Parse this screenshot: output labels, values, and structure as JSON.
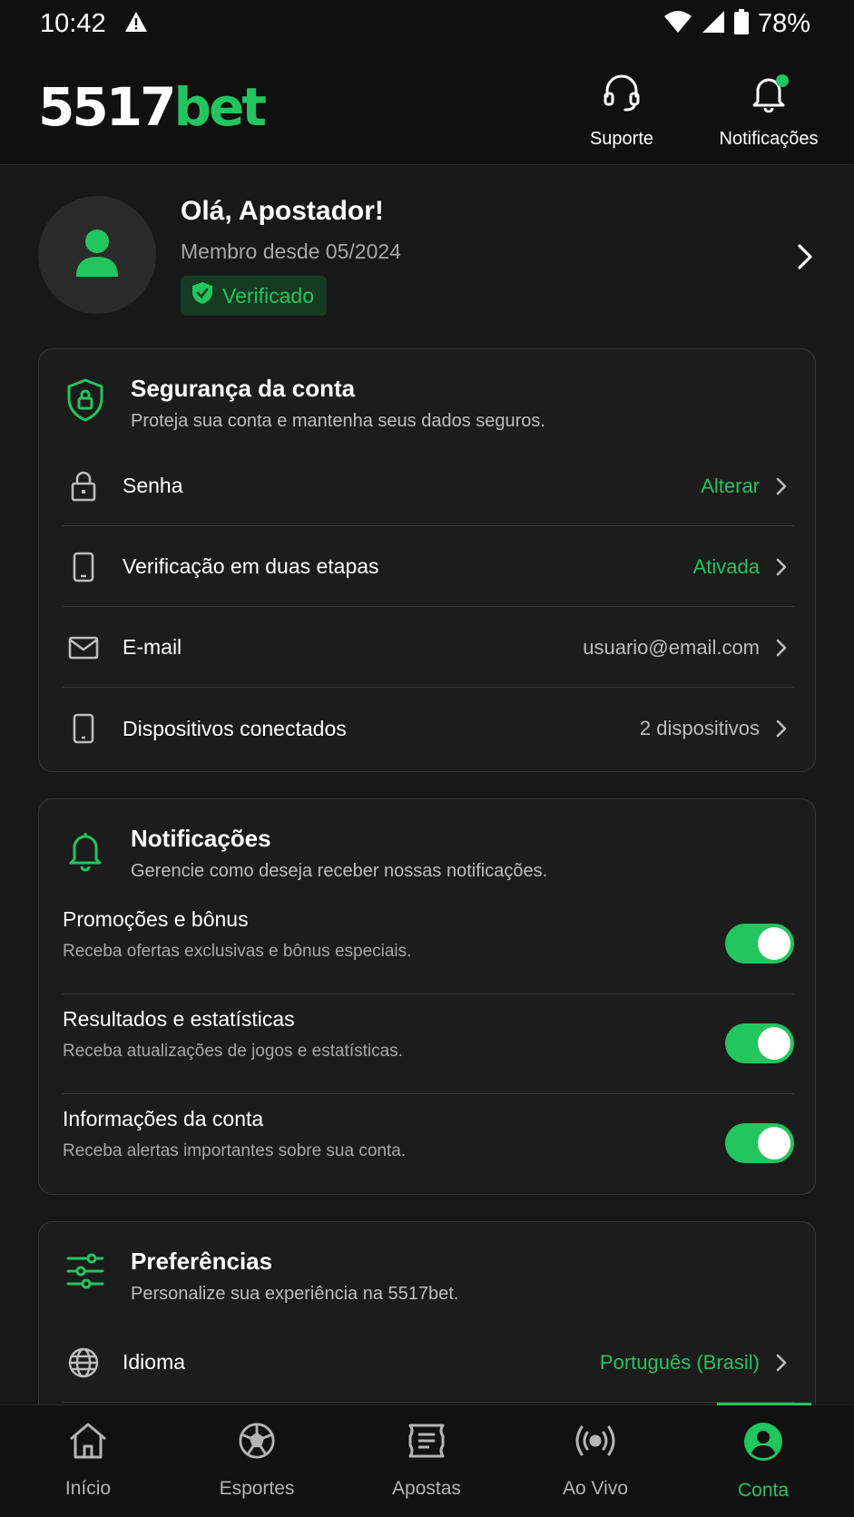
{
  "status_bar": {
    "time": "10:42",
    "battery": "78%"
  },
  "header": {
    "logo_number": "5517",
    "logo_word": "bet",
    "support_label": "Suporte",
    "notifications_label": "Notificações"
  },
  "profile": {
    "greeting": "Olá, Apostador!",
    "member_since": "Membro desde 05/2024",
    "verified_label": "Verificado"
  },
  "security": {
    "title": "Segurança da conta",
    "subtitle": "Proteja sua conta e mantenha seus dados seguros.",
    "rows": [
      {
        "label": "Senha",
        "value": "Alterar",
        "icon": "lock-icon"
      },
      {
        "label": "Verificação em duas etapas",
        "value": "Ativada",
        "icon": "phone-icon"
      },
      {
        "label": "E-mail",
        "value": "usuario@email.com",
        "icon": "mail-icon"
      },
      {
        "label": "Dispositivos conectados",
        "value": "2 dispositivos",
        "icon": "device-icon"
      }
    ]
  },
  "notifications": {
    "title": "Notificações",
    "subtitle": "Gerencie como deseja receber nossas notificações.",
    "items": [
      {
        "title": "Promoções e bônus",
        "desc": "Receba ofertas exclusivas e bônus especiais.",
        "enabled": true
      },
      {
        "title": "Resultados e estatísticas",
        "desc": "Receba atualizações de jogos e estatísticas.",
        "enabled": true
      },
      {
        "title": "Informações da conta",
        "desc": "Receba alertas importantes sobre sua conta.",
        "enabled": true
      }
    ]
  },
  "preferences": {
    "title": "Preferências",
    "subtitle": "Personalize sua experiência na 5517bet.",
    "rows": [
      {
        "label": "Idioma",
        "value": "Português (Brasil)",
        "icon": "globe-icon"
      }
    ]
  },
  "bottom_nav": {
    "items": [
      {
        "label": "Início",
        "icon": "home-icon"
      },
      {
        "label": "Esportes",
        "icon": "soccer-ball-icon"
      },
      {
        "label": "Apostas",
        "icon": "ticket-icon"
      },
      {
        "label": "Ao Vivo",
        "icon": "live-icon"
      },
      {
        "label": "Conta",
        "icon": "account-icon"
      }
    ],
    "active": "Conta"
  },
  "colors": {
    "accent": "#22c55e",
    "background": "#181818",
    "card": "#1c1c1c"
  }
}
